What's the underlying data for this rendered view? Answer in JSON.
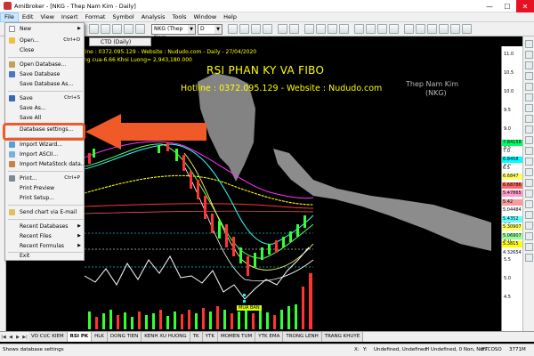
{
  "window": {
    "app_title": "AmiBroker - [NKG - Thep Nam Kim - Daily]"
  },
  "menubar": [
    "File",
    "Edit",
    "View",
    "Insert",
    "Format",
    "Symbol",
    "Analysis",
    "Tools",
    "Window",
    "Help"
  ],
  "toolbar": {
    "symbol_value": "NKG (Thep Nam",
    "interval_value": "D",
    "chart_tab": "CTD (Daily)"
  },
  "file_menu": {
    "items": [
      {
        "label": "New",
        "shortcut": "",
        "submenu": true
      },
      {
        "label": "Open...",
        "shortcut": "Ctrl+O"
      },
      {
        "label": "Close",
        "shortcut": ""
      },
      {
        "label": "Open Database...",
        "shortcut": ""
      },
      {
        "label": "Save Database",
        "shortcut": ""
      },
      {
        "label": "Save Database As...",
        "shortcut": ""
      },
      {
        "label": "Save",
        "shortcut": "Ctrl+S"
      },
      {
        "label": "Save As...",
        "shortcut": ""
      },
      {
        "label": "Save All",
        "shortcut": ""
      },
      {
        "label": "Database settings...",
        "shortcut": ""
      },
      {
        "label": "Import Wizard...",
        "shortcut": ""
      },
      {
        "label": "Import ASCII...",
        "shortcut": ""
      },
      {
        "label": "Import MetaStock data...",
        "shortcut": ""
      },
      {
        "label": "Print...",
        "shortcut": "Ctrl+P"
      },
      {
        "label": "Print Preview",
        "shortcut": ""
      },
      {
        "label": "Print Setup...",
        "shortcut": ""
      },
      {
        "label": "Send chart via E-mail",
        "shortcut": ""
      },
      {
        "label": "Recent Databases",
        "shortcut": "",
        "submenu": true
      },
      {
        "label": "Recent Files",
        "shortcut": "",
        "submenu": true
      },
      {
        "label": "Recent Formulas",
        "shortcut": "",
        "submenu": true
      },
      {
        "label": "Exit",
        "shortcut": ""
      }
    ]
  },
  "chart": {
    "info_line": "line : 0372.095.129 - Website : Nududo.com - Daily - 27/04/2020",
    "info_line2": "ng cua-6.66  Khoi Luong= 2,943,180.000",
    "promo_title": "RSI PHAN KY VA FIBO",
    "promo_sub": "Hotline : 0372.095.129 - Website : Nududo.com",
    "watermark_name": "Thep Nam Kim",
    "watermark_symbol": "(NKG)",
    "signal_label": "MUA BAN",
    "price_ticks": [
      "11.0",
      "10.5",
      "10.0",
      "9.5",
      "9.0",
      "8.5",
      "8.0",
      "7.5",
      "7.0",
      "6.5",
      "6.0",
      "5.5",
      "5.0",
      "4.5"
    ],
    "price_tags": [
      {
        "text": "7.84158",
        "color": "#00ff66"
      },
      {
        "text": "7.0",
        "color": "#ffffff"
      },
      {
        "text": "6.8458",
        "color": "#00ffff"
      },
      {
        "text": "6.5",
        "color": "#ffffff"
      },
      {
        "text": "6.6847",
        "color": "#ffff66"
      },
      {
        "text": "6.68786",
        "color": "#ff6666"
      },
      {
        "text": "5.47865",
        "color": "#ff99cc"
      },
      {
        "text": "5.42",
        "color": "#ff9999"
      },
      {
        "text": "5.04484",
        "color": "#ffffff"
      },
      {
        "text": "5.4352",
        "color": "#66ffff"
      },
      {
        "text": "5.30907",
        "color": "#ffff66"
      },
      {
        "text": "5.06907",
        "color": "#99ff99"
      },
      {
        "text": "5.3815",
        "color": "#ffff00"
      },
      {
        "text": "4.32654",
        "color": "#ffffff"
      }
    ]
  },
  "sheet_tabs": [
    "VO CUC KIEM",
    "RSI PK",
    "HLK",
    "DONG TIEN",
    "KENH XU HUONG",
    "TK",
    "YTK",
    "MOMEN TUM",
    "YTK EMA",
    "TRONG LENH",
    "TRANG KHUYE"
  ],
  "active_tab": "RSI PK",
  "statusbar": {
    "message": "Shows database settings",
    "x_label": "X:",
    "y_label": "Y:",
    "undefined1": "Undefined, Undefined",
    "undefined2": "H Undefined, 0 Non, Non",
    "mode": "IFTCOSO",
    "memory": "3771M"
  }
}
